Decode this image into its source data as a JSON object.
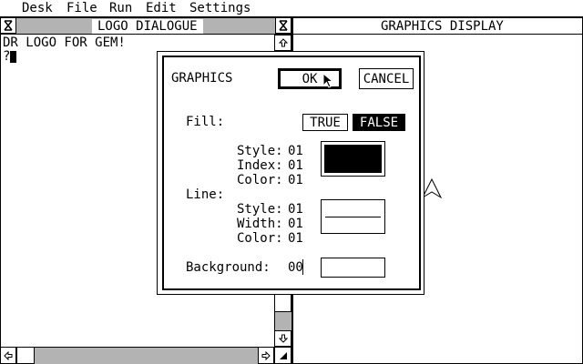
{
  "menu": {
    "items": [
      "Desk",
      "File",
      "Run",
      "Edit",
      "Settings"
    ]
  },
  "logo_window": {
    "title": "LOGO DIALOGUE",
    "lines": [
      "DR LOGO FOR GEM!",
      "?"
    ]
  },
  "graphics_window": {
    "title": "GRAPHICS DISPLAY"
  },
  "dialog": {
    "title": "GRAPHICS",
    "ok_label": "OK",
    "cancel_label": "CANCEL",
    "fill_label": "Fill:",
    "fill_true_label": "TRUE",
    "fill_false_label": "FALSE",
    "fill_selected": "FALSE",
    "fill_style_label": "Style:",
    "fill_style_value": "01",
    "fill_index_label": "Index:",
    "fill_index_value": "01",
    "fill_color_label": "Color:",
    "fill_color_value": "01",
    "line_label": "Line:",
    "line_style_label": "Style:",
    "line_style_value": "01",
    "line_width_label": "Width:",
    "line_width_value": "01",
    "line_color_label": "Color:",
    "line_color_value": "01",
    "background_label": "Background:",
    "background_value": "00"
  },
  "icons": {
    "close": "close-icon",
    "fuller": "fuller-icon",
    "up": "up-arrow-icon",
    "down": "down-arrow-icon",
    "left": "left-arrow-icon",
    "right": "right-arrow-icon",
    "size": "size-icon",
    "turtle": "turtle-icon",
    "mouse": "mouse-pointer-icon"
  },
  "colors": {
    "foreground": "#000000",
    "background": "#ffffff"
  }
}
